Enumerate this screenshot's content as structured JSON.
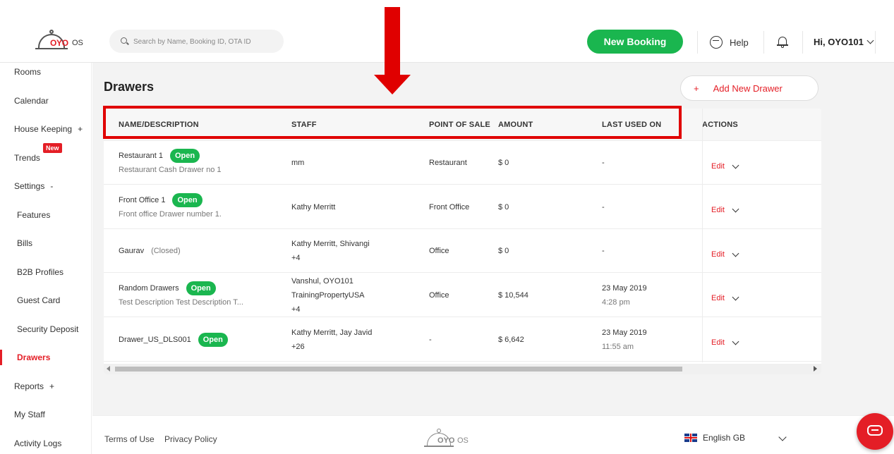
{
  "header": {
    "logo_word": "OYO",
    "logo_os": "OS",
    "search_placeholder": "Search by Name, Booking ID, OTA ID",
    "new_booking_label": "New Booking",
    "help_label": "Help",
    "user_greeting": "Hi, OYO101"
  },
  "sidebar": {
    "items": [
      {
        "label": "Rooms",
        "suffix": ""
      },
      {
        "label": "Calendar",
        "suffix": ""
      },
      {
        "label": "House Keeping",
        "suffix": "+"
      },
      {
        "label": "Trends",
        "suffix": "",
        "badge": "New"
      },
      {
        "label": "Settings",
        "suffix": "-"
      },
      {
        "label": "Features",
        "suffix": ""
      },
      {
        "label": "Bills",
        "suffix": ""
      },
      {
        "label": "B2B Profiles",
        "suffix": ""
      },
      {
        "label": "Guest Card",
        "suffix": ""
      },
      {
        "label": "Security Deposit",
        "suffix": ""
      },
      {
        "label": "Drawers",
        "suffix": "",
        "active": true
      },
      {
        "label": "Reports",
        "suffix": "+"
      },
      {
        "label": "My Staff",
        "suffix": ""
      },
      {
        "label": "Activity Logs",
        "suffix": ""
      }
    ]
  },
  "main": {
    "title": "Drawers",
    "add_button": {
      "icon": "+",
      "label": "Add New Drawer"
    },
    "table": {
      "columns": [
        "NAME/DESCRIPTION",
        "STAFF",
        "POINT OF SALE",
        "AMOUNT",
        "LAST USED ON",
        "ACTIONS"
      ],
      "rows": [
        {
          "name": "Restaurant 1",
          "status": "Open",
          "description": "Restaurant Cash Drawer no 1",
          "staff": [
            "mm"
          ],
          "pos": "Restaurant",
          "amount": "$ 0",
          "last_used": [
            "-"
          ],
          "action": "Edit"
        },
        {
          "name": "Front Office 1",
          "status": "Open",
          "description": "Front office Drawer number 1.",
          "staff": [
            "Kathy Merritt"
          ],
          "pos": "Front Office",
          "amount": "$ 0",
          "last_used": [
            "-"
          ],
          "action": "Edit"
        },
        {
          "name": "Gaurav",
          "status": "(Closed)",
          "description": "",
          "staff": [
            "Kathy Merritt, Shivangi",
            "+4"
          ],
          "pos": "Office",
          "amount": "$ 0",
          "last_used": [
            "-"
          ],
          "action": "Edit"
        },
        {
          "name": "Random Drawers",
          "status": "Open",
          "description": "Test Description Test Description T...",
          "staff": [
            "Vanshul, OYO101",
            "TrainingPropertyUSA",
            "+4"
          ],
          "pos": "Office",
          "amount": "$ 10,544",
          "last_used": [
            "23 May 2019",
            "4:28 pm"
          ],
          "action": "Edit"
        },
        {
          "name": "Drawer_US_DLS001",
          "status": "Open",
          "description": "",
          "staff": [
            "Kathy Merritt, Jay Javid",
            "+26"
          ],
          "pos": "-",
          "amount": "$ 6,642",
          "last_used": [
            "23 May 2019",
            "11:55 am"
          ],
          "action": "Edit"
        }
      ]
    }
  },
  "footer": {
    "terms": "Terms of Use",
    "privacy": "Privacy Policy",
    "logo_word": "OYO",
    "logo_os": "OS",
    "language": "English GB"
  },
  "colors": {
    "brand_red": "#e41e26",
    "open_green": "#1ab64f",
    "annotation_red": "#e00000"
  }
}
